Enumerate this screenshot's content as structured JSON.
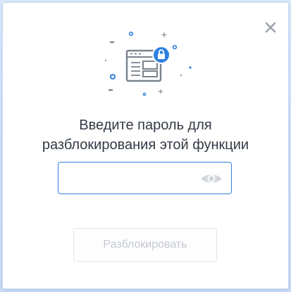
{
  "dialog": {
    "prompt_line1": "Введите пароль для",
    "prompt_line2": "разблокирования этой функции",
    "password_value": "",
    "unlock_button_label": "Разблокировать",
    "unlock_button_enabled": false
  },
  "icons": {
    "close": "close-icon",
    "illustration": "locked-window-icon",
    "lock_badge": "lock-icon",
    "show_password": "eye-icon"
  },
  "colors": {
    "accent": "#2f80e0",
    "text": "#333a45",
    "icon_gray": "#7a828c",
    "disabled_text": "#c4c9cf",
    "backdrop": "#cfe0fa"
  }
}
